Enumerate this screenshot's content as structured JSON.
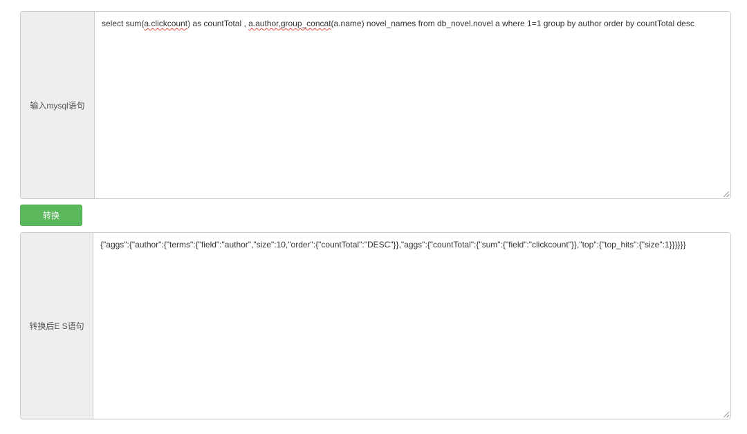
{
  "sql_section": {
    "label": "输入mysql语句",
    "text_parts": [
      "select sum(",
      "a.clickcount",
      ") as countTotal , ",
      "a.author,group_concat",
      "(a.name) novel_names from db_novel.novel a where 1=1 group by author order by countTotal desc"
    ]
  },
  "convert_button": {
    "label": "转换"
  },
  "es_section": {
    "label": "转换后E S语句",
    "text": "{\"aggs\":{\"author\":{\"terms\":{\"field\":\"author\",\"size\":10,\"order\":{\"countTotal\":\"DESC\"}},\"aggs\":{\"countTotal\":{\"sum\":{\"field\":\"clickcount\"}},\"top\":{\"top_hits\":{\"size\":1}}}}}}"
  },
  "colors": {
    "button": "#5cb85c",
    "addon_bg": "#eeeeee",
    "border": "#cccccc",
    "spellcheck": "#e0453a"
  }
}
